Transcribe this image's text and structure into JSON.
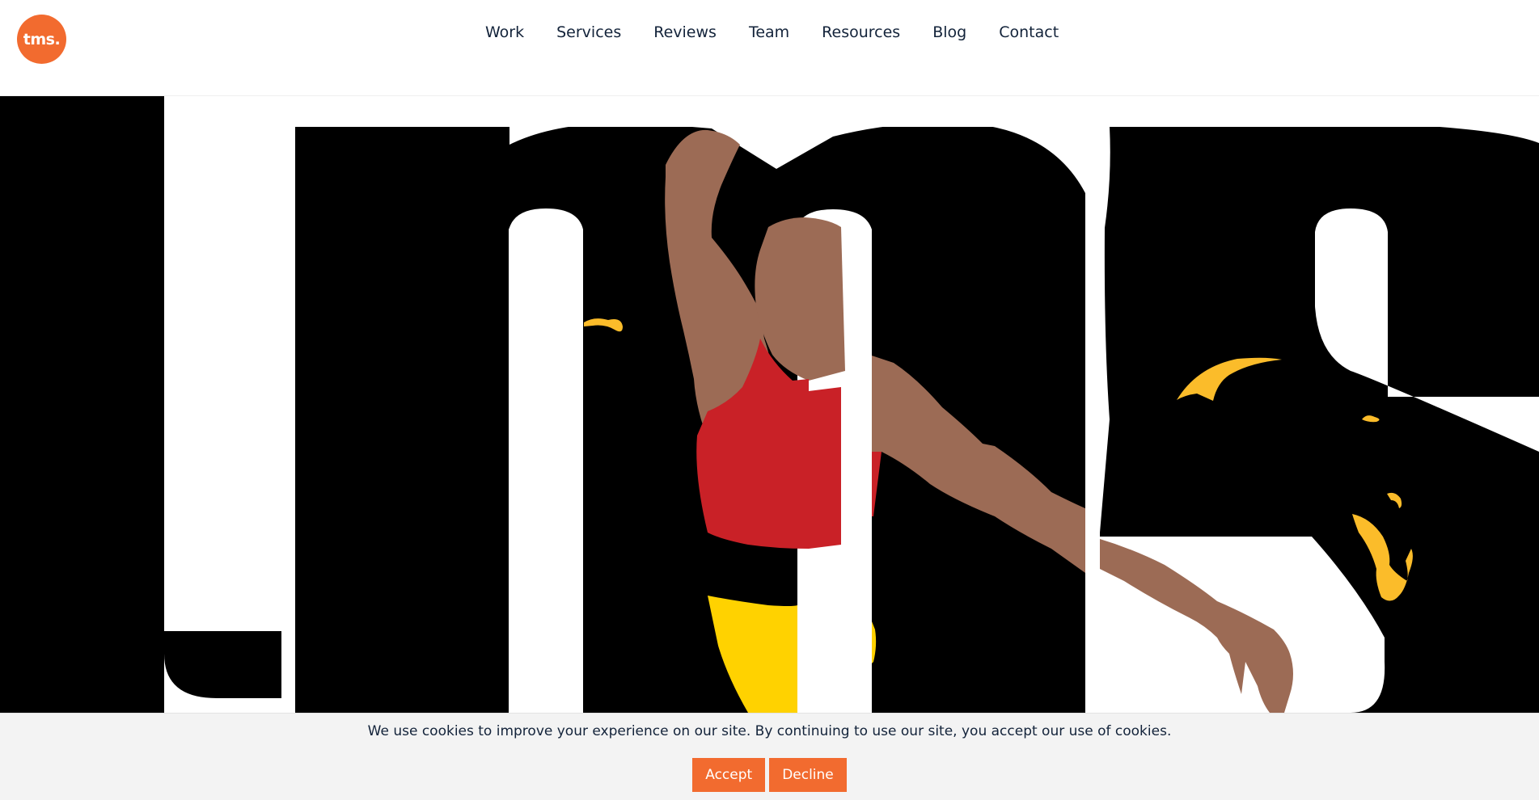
{
  "logo": {
    "text": "tms.",
    "color": "#f26b2f"
  },
  "nav": {
    "items": [
      {
        "label": "Work"
      },
      {
        "label": "Services"
      },
      {
        "label": "Reviews"
      },
      {
        "label": "Team"
      },
      {
        "label": "Resources"
      },
      {
        "label": "Blog"
      },
      {
        "label": "Contact"
      }
    ]
  },
  "hero": {
    "illustration": "tms-lettering-with-athlete-illustration",
    "colors": {
      "lettering": "#000000",
      "skin": "#9c6b55",
      "shirt": "#c92127",
      "shorts": "#ffd200",
      "splash": "#fbbc2a"
    }
  },
  "cookie_banner": {
    "message": "We use cookies to improve your experience on our site. By continuing to use our site, you accept our use of cookies.",
    "accept_label": "Accept",
    "decline_label": "Decline",
    "button_color": "#f26b2f"
  }
}
